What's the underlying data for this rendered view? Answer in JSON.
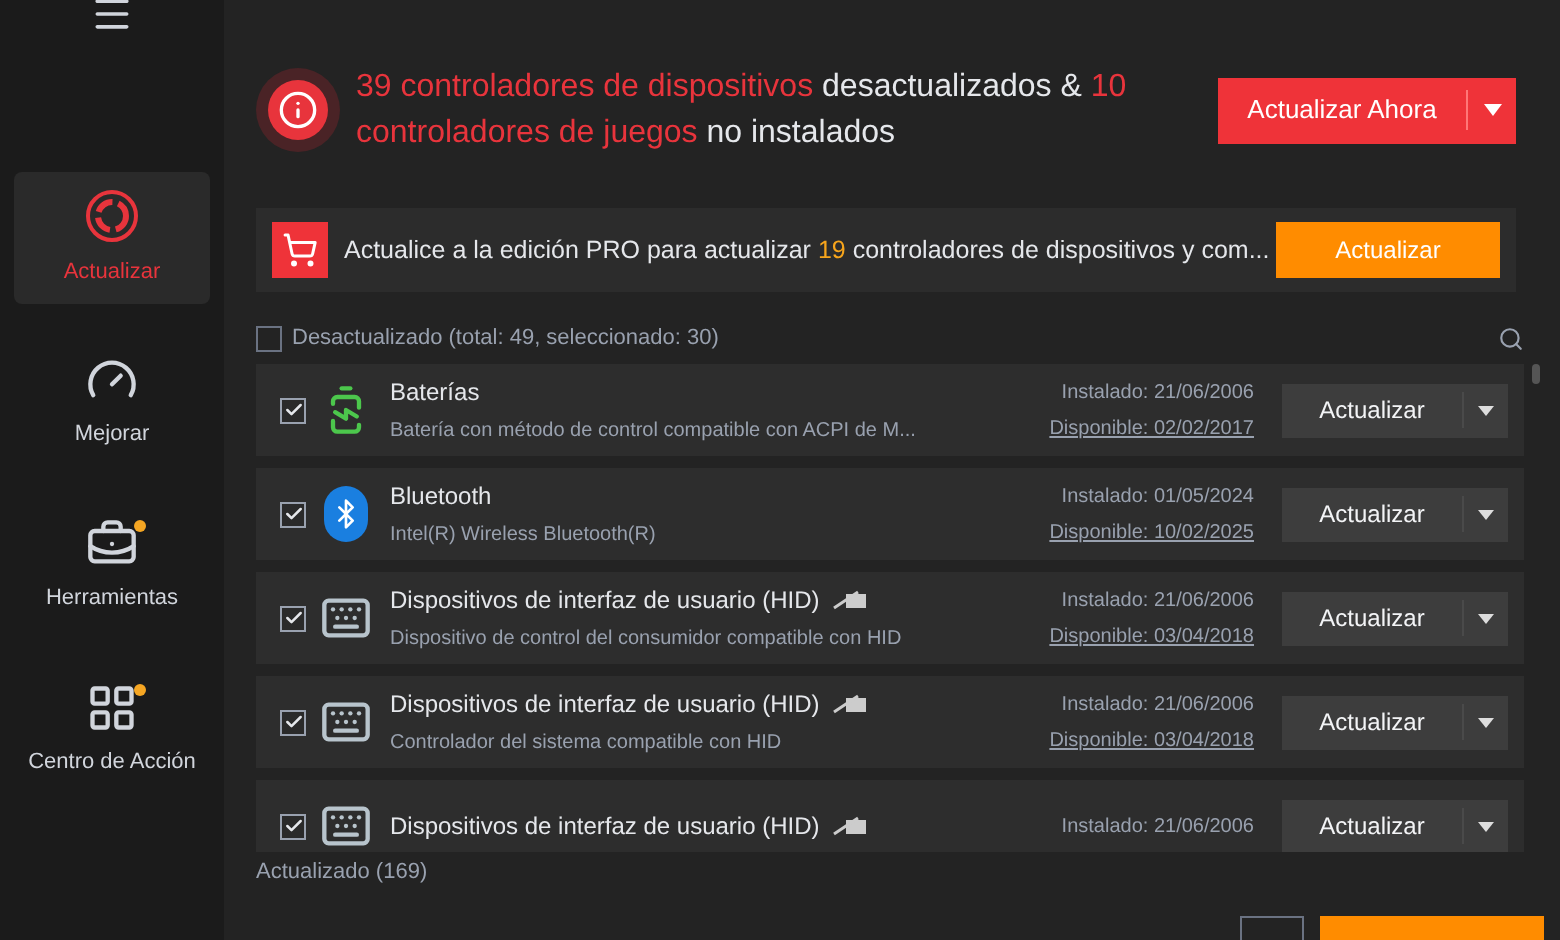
{
  "sidebar": {
    "items": [
      {
        "label": "Actualizar",
        "kind": "update",
        "selected": true,
        "badge": false
      },
      {
        "label": "Mejorar",
        "kind": "gauge",
        "selected": false,
        "badge": false
      },
      {
        "label": "Herramientas",
        "kind": "toolbox",
        "selected": false,
        "badge": true
      },
      {
        "label": "Centro de Acción",
        "kind": "apps",
        "selected": false,
        "badge": true
      }
    ]
  },
  "alert": {
    "segments": [
      {
        "text": "39 controladores de dispositivos",
        "highlight": true
      },
      {
        "text": " desactualizados & ",
        "highlight": false
      },
      {
        "text": "10 controladores de juegos",
        "highlight": true
      },
      {
        "text": " no instalados",
        "highlight": false
      }
    ],
    "button": "Actualizar Ahora"
  },
  "promo": {
    "text_before": "Actualice a la edición PRO para actualizar ",
    "count": "19",
    "text_after": " controladores de dispositivos y com...",
    "button": "Actualizar"
  },
  "outdated": {
    "label": "Desactualizado (total: 49, seleccionado: 30)",
    "checked": false
  },
  "drivers": [
    {
      "kind": "battery",
      "name": "Baterías",
      "flag": false,
      "description": "Batería con método de control compatible con ACPI de M...",
      "installed": "Instalado: 21/06/2006",
      "available": "Disponible: 02/02/2017",
      "checked": true,
      "button": "Actualizar"
    },
    {
      "kind": "bluetooth",
      "name": "Bluetooth",
      "flag": false,
      "description": "Intel(R) Wireless Bluetooth(R)",
      "installed": "Instalado: 01/05/2024",
      "available": "Disponible: 10/02/2025",
      "checked": true,
      "button": "Actualizar"
    },
    {
      "kind": "hid",
      "name": "Dispositivos de interfaz de usuario (HID)",
      "flag": true,
      "description": "Dispositivo de control del consumidor compatible con HID",
      "installed": "Instalado: 21/06/2006",
      "available": "Disponible: 03/04/2018",
      "checked": true,
      "button": "Actualizar"
    },
    {
      "kind": "hid",
      "name": "Dispositivos de interfaz de usuario (HID)",
      "flag": true,
      "description": "Controlador del sistema compatible con HID",
      "installed": "Instalado: 21/06/2006",
      "available": "Disponible: 03/04/2018",
      "checked": true,
      "button": "Actualizar"
    },
    {
      "kind": "hid",
      "name": "Dispositivos de interfaz de usuario (HID)",
      "flag": true,
      "installed": "Instalado: 21/06/2006",
      "checked": true,
      "button": "Actualizar"
    }
  ],
  "updated": {
    "label": "Actualizado (169)"
  }
}
